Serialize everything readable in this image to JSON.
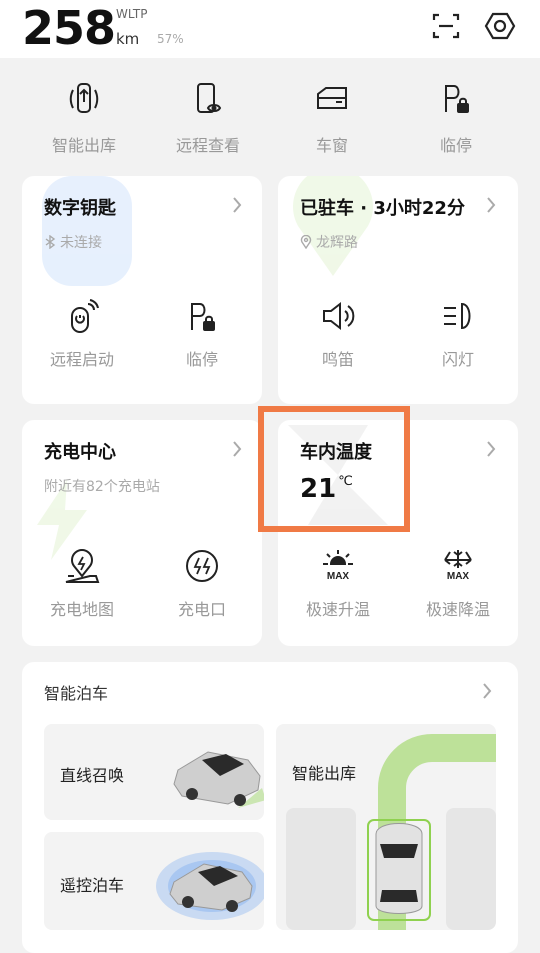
{
  "header": {
    "range_value": "258",
    "range_standard": "WLTP",
    "range_unit": "km",
    "battery_percent": "57%",
    "scan_icon": "scan-icon",
    "settings_icon": "settings-icon"
  },
  "quick_actions": [
    {
      "label": "智能出库",
      "icon": "smart-exit-icon"
    },
    {
      "label": "远程查看",
      "icon": "remote-view-icon"
    },
    {
      "label": "车窗",
      "icon": "window-icon"
    },
    {
      "label": "临停",
      "icon": "temp-parking-icon"
    }
  ],
  "digital_key": {
    "title": "数字钥匙",
    "status": "未连接",
    "actions": [
      {
        "label": "远程启动",
        "icon": "remote-start-icon"
      },
      {
        "label": "临停",
        "icon": "temp-parking-icon"
      }
    ]
  },
  "parked": {
    "title": "已驻车 · 3小时22分",
    "location": "龙辉路",
    "actions": [
      {
        "label": "鸣笛",
        "icon": "horn-icon"
      },
      {
        "label": "闪灯",
        "icon": "flash-lights-icon"
      }
    ]
  },
  "charging": {
    "title": "充电中心",
    "subtitle": "附近有82个充电站",
    "actions": [
      {
        "label": "充电地图",
        "icon": "charging-map-icon"
      },
      {
        "label": "充电口",
        "icon": "charging-port-icon"
      }
    ]
  },
  "cabin_temp": {
    "title": "车内温度",
    "value": "21",
    "unit": "℃",
    "actions": [
      {
        "label": "极速升温",
        "icon": "max-heat-icon",
        "badge": "MAX"
      },
      {
        "label": "极速降温",
        "icon": "max-cool-icon",
        "badge": "MAX"
      }
    ]
  },
  "smart_parking": {
    "title": "智能泊车",
    "tiles": [
      {
        "label": "直线召唤"
      },
      {
        "label": "遥控泊车"
      },
      {
        "label": "智能出库"
      }
    ]
  },
  "colors": {
    "highlight": "#f07a45",
    "accent_green": "#8fd14f",
    "accent_blue": "#4a8ff0"
  }
}
